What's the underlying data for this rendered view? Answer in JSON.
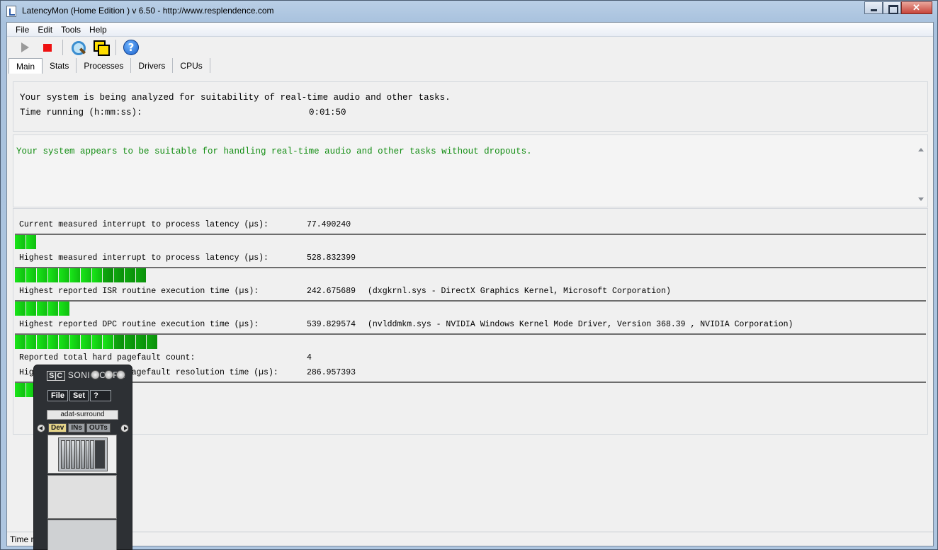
{
  "window": {
    "title": "LatencyMon  (Home Edition )  v 6.50 - http://www.resplendence.com"
  },
  "menu": [
    "File",
    "Edit",
    "Tools",
    "Help"
  ],
  "toolbar": {
    "start": "play-icon",
    "stop": "stop-icon",
    "find": "search-icon",
    "windows": "windows-icon",
    "help": "help-icon"
  },
  "tabs": [
    "Main",
    "Stats",
    "Processes",
    "Drivers",
    "CPUs"
  ],
  "analysis": {
    "status_line": "Your system is being analyzed for suitability of real-time audio and other tasks.",
    "time_label": "Time running (h:mm:ss):",
    "time_value": "0:01:50"
  },
  "verdict": {
    "text": "Your system appears to be suitable for handling real-time audio and other tasks without dropouts.",
    "color": "#128d12"
  },
  "metrics": [
    {
      "label": "Current measured interrupt to process latency (µs):",
      "value": "77.490240",
      "detail": "",
      "bar_fraction": 0.025
    },
    {
      "label": "Highest measured interrupt to process latency (µs):",
      "value": "528.832399",
      "detail": "",
      "bar_fraction": 0.145
    },
    {
      "label": "Highest reported ISR routine execution time (µs):",
      "value": "242.675689",
      "detail": "(dxgkrnl.sys - DirectX Graphics Kernel, Microsoft Corporation)",
      "bar_fraction": 0.065
    },
    {
      "label": "Highest reported DPC routine execution time (µs):",
      "value": "539.829574",
      "detail": "(nvlddmkm.sys - NVIDIA Windows Kernel Mode Driver, Version 368.39 , NVIDIA Corporation)",
      "bar_fraction": 0.157
    },
    {
      "label": "Reported total hard pagefault count:",
      "value": "4",
      "detail": ""
    },
    {
      "label": "Highest reported hard pagefault resolution time (µs):",
      "value": "286.957393",
      "detail": "",
      "bar_fraction": 0.025
    }
  ],
  "statusbar": {
    "text": "Time r"
  },
  "soniccore": {
    "logo": "S|C",
    "title": "SONIC CORE",
    "buttons": [
      "File",
      "Set",
      "?"
    ],
    "device": "adat-surround",
    "tabs": [
      "Dev",
      "INs",
      "OUTs"
    ]
  }
}
